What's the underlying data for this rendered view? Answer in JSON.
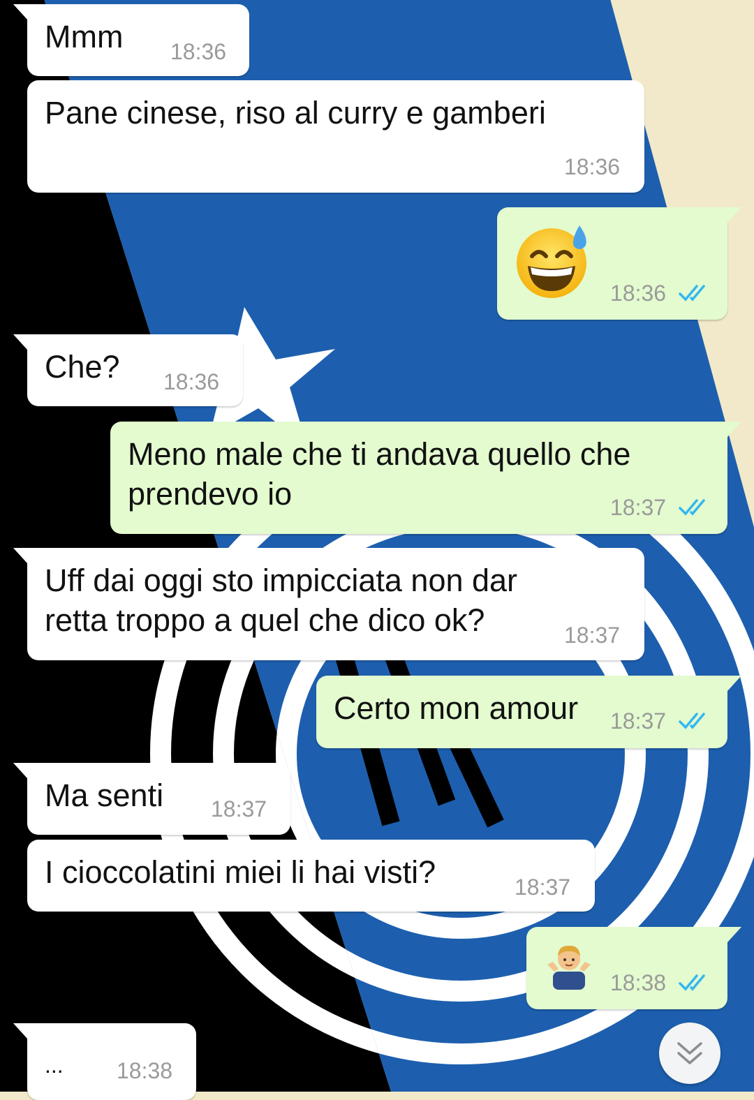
{
  "theme": {
    "incoming_bubble": "#ffffff",
    "outgoing_bubble": "#e3fbcf",
    "time_color": "#9a9a9a",
    "read_ticks_color": "#34b7f1",
    "wallpaper_colors": [
      "#f1e9c9",
      "#000000",
      "#1d5fae",
      "#ffffff"
    ]
  },
  "messages": [
    {
      "direction": "incoming",
      "text": "Mmm",
      "time": "18:36"
    },
    {
      "direction": "incoming",
      "text": "Pane cinese, riso al curry e gamberi",
      "time": "18:36"
    },
    {
      "direction": "outgoing",
      "emoji": "grinning-face-with-sweat",
      "time": "18:36",
      "status": "read"
    },
    {
      "direction": "incoming",
      "text": "Che?",
      "time": "18:36"
    },
    {
      "direction": "outgoing",
      "text": "Meno male che ti andava quello che\nprendevo io",
      "time": "18:37",
      "status": "read"
    },
    {
      "direction": "incoming",
      "text": "Uff dai oggi sto impicciata non dar\nretta troppo a quel che dico ok?",
      "time": "18:37"
    },
    {
      "direction": "outgoing",
      "text": "Certo mon amour",
      "time": "18:37",
      "status": "read"
    },
    {
      "direction": "incoming",
      "text": "Ma senti",
      "time": "18:37"
    },
    {
      "direction": "incoming",
      "text": "I cioccolatini miei li hai visti?",
      "time": "18:37"
    },
    {
      "direction": "outgoing",
      "emoji": "man-shrugging",
      "time": "18:38",
      "status": "read"
    },
    {
      "direction": "incoming",
      "text": "...",
      "time": "18:38"
    }
  ],
  "scroll_down": {
    "icon": "double-chevron-down-icon"
  }
}
